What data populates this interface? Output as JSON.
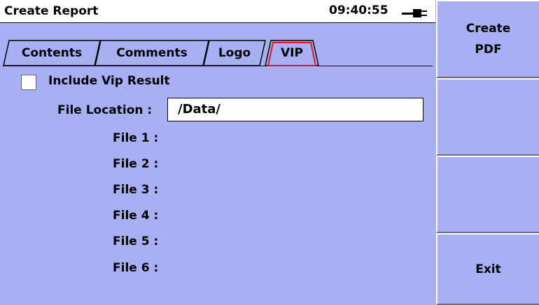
{
  "header": {
    "title": "Create Report",
    "time": "09:40:55"
  },
  "tabs": [
    {
      "label": "Contents",
      "active": false
    },
    {
      "label": "Comments",
      "active": false
    },
    {
      "label": "Logo",
      "active": false
    },
    {
      "label": "VIP",
      "active": true
    }
  ],
  "vip": {
    "include_label": "Include Vip Result",
    "include_checked": false,
    "file_location_label": "File Location :",
    "file_location_value": "/Data/",
    "files": [
      {
        "label": "File 1 :",
        "value": ""
      },
      {
        "label": "File 2 :",
        "value": ""
      },
      {
        "label": "File 3 :",
        "value": ""
      },
      {
        "label": "File 4 :",
        "value": ""
      },
      {
        "label": "File 5 :",
        "value": ""
      },
      {
        "label": "File 6 :",
        "value": ""
      }
    ]
  },
  "sidebar": {
    "create_pdf_line1": "Create",
    "create_pdf_line2": "PDF",
    "blank1": "",
    "blank2": "",
    "exit": "Exit"
  },
  "colors": {
    "background": "#a6b0f2",
    "active_tab_border": "#e0142a"
  },
  "icons": {
    "power": "plug-icon"
  }
}
